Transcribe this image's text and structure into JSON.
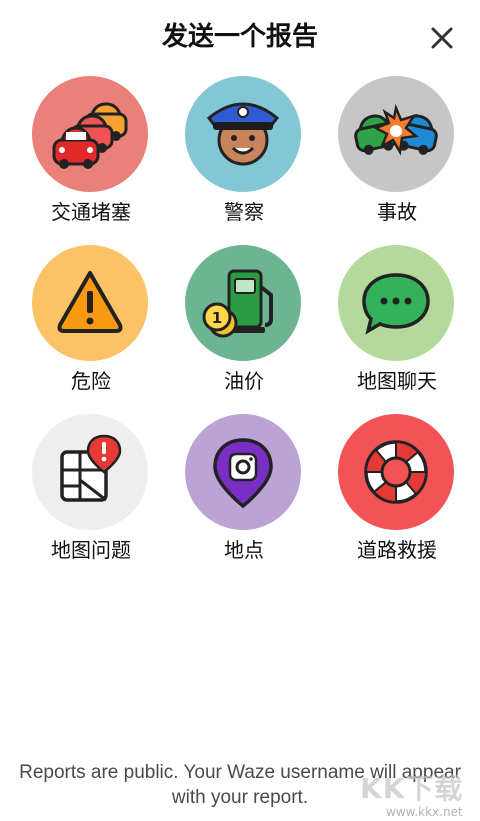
{
  "header": {
    "title": "发送一个报告"
  },
  "colors": {
    "traffic": "#e98079",
    "police": "#82c7d3",
    "crash": "#c6c6c6",
    "hazard": "#fbc266",
    "gas": "#6db592",
    "chat": "#b3d99b",
    "map_issue": "#eeeeee",
    "place": "#bba4d5",
    "roadside": "#f25456"
  },
  "tiles": [
    {
      "label": "交通堵塞",
      "icon": "traffic-jam-icon"
    },
    {
      "label": "警察",
      "icon": "police-officer-icon"
    },
    {
      "label": "事故",
      "icon": "car-crash-icon"
    },
    {
      "label": "危险",
      "icon": "hazard-warning-icon"
    },
    {
      "label": "油价",
      "icon": "gas-pump-icon"
    },
    {
      "label": "地图聊天",
      "icon": "chat-bubble-icon"
    },
    {
      "label": "地图问题",
      "icon": "map-issue-icon"
    },
    {
      "label": "地点",
      "icon": "camera-pin-icon"
    },
    {
      "label": "道路救援",
      "icon": "lifebuoy-icon"
    }
  ],
  "footer": {
    "text": "Reports are public. Your Waze username will appear with your report."
  },
  "watermark": {
    "brand": "KK下载",
    "domain": "www.kkx.net"
  }
}
